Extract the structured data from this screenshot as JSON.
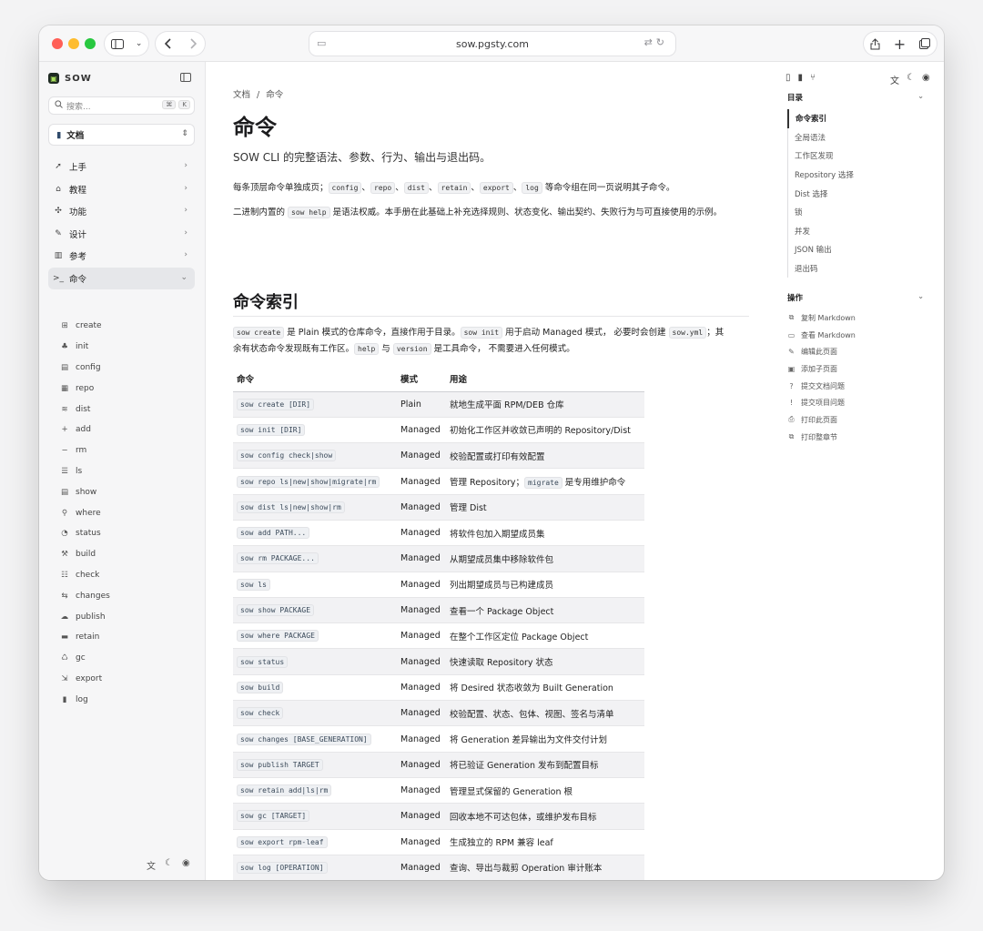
{
  "browser": {
    "url": "sow.pgsty.com",
    "back_icon": "chevron-left-icon",
    "forward_icon": "chevron-right-icon"
  },
  "sidebar": {
    "brand": "SOW",
    "search_placeholder": "搜索...",
    "search_kbd_1": "⌘",
    "search_kbd_2": "K",
    "doc_select": "文档",
    "nav": [
      {
        "label": "上手",
        "icon": "rocket-icon"
      },
      {
        "label": "教程",
        "icon": "graduation-cap-icon"
      },
      {
        "label": "功能",
        "icon": "puzzle-icon"
      },
      {
        "label": "设计",
        "icon": "compass-icon"
      },
      {
        "label": "参考",
        "icon": "book-icon"
      },
      {
        "label": "命令",
        "icon": "terminal-icon"
      }
    ],
    "subnav": [
      "create",
      "init",
      "config",
      "repo",
      "dist",
      "add",
      "rm",
      "ls",
      "show",
      "where",
      "status",
      "build",
      "check",
      "changes",
      "publish",
      "retain",
      "gc",
      "export",
      "log"
    ]
  },
  "main": {
    "breadcrumb_root": "文档",
    "breadcrumb_sep": "/",
    "breadcrumb_current": "命令",
    "title": "命令",
    "lead": "SOW CLI 的完整语法、参数、行为、输出与退出码。",
    "p1": {
      "text_a": "每条顶层命令单独成页；",
      "codes": [
        "config",
        "repo",
        "dist",
        "retain",
        "export",
        "log"
      ],
      "sep": "、",
      "text_b": " 等命令组在同一页说明其子命令。"
    },
    "p2": {
      "text_a": "二进制内置的 ",
      "code": "sow help",
      "text_b": " 是语法权威。本手册在此基础上补充选择规则、状态变化、输出契约、失败行为与可直接使用的示例。"
    },
    "section_title": "命令索引",
    "p3": {
      "code1": "sow create",
      "t1": " 是 Plain 模式的仓库命令，直接作用于目录。",
      "code2": "sow init",
      "t2": " 用于启动 Managed 模式， 必要时会创建 ",
      "code3": "sow.yml",
      "t3": "；其余有状态命令发现既有工作区。",
      "code4": "help",
      "t4": " 与 ",
      "code5": "version",
      "t5": " 是工具命令， 不需要进入任何模式。"
    },
    "table": {
      "headers": [
        "命令",
        "模式",
        "用途"
      ],
      "rows": [
        {
          "cmd": "sow create [DIR]",
          "mode": "Plain",
          "use": "就地生成平面 RPM/DEB 仓库"
        },
        {
          "cmd": "sow init [DIR]",
          "mode": "Managed",
          "use": "初始化工作区并收敛已声明的 Repository/Dist"
        },
        {
          "cmd": "sow config check|show",
          "mode": "Managed",
          "use": "校验配置或打印有效配置"
        },
        {
          "cmd": "sow repo ls|new|show|migrate|rm",
          "mode": "Managed",
          "use": "管理 Repository；",
          "use_code": "migrate",
          "use_tail": " 是专用维护命令"
        },
        {
          "cmd": "sow dist ls|new|show|rm",
          "mode": "Managed",
          "use": "管理 Dist"
        },
        {
          "cmd": "sow add PATH...",
          "mode": "Managed",
          "use": "将软件包加入期望成员集"
        },
        {
          "cmd": "sow rm PACKAGE...",
          "mode": "Managed",
          "use": "从期望成员集中移除软件包"
        },
        {
          "cmd": "sow ls",
          "mode": "Managed",
          "use": "列出期望成员与已构建成员"
        },
        {
          "cmd": "sow show PACKAGE",
          "mode": "Managed",
          "use": "查看一个 Package Object"
        },
        {
          "cmd": "sow where PACKAGE",
          "mode": "Managed",
          "use": "在整个工作区定位 Package Object"
        },
        {
          "cmd": "sow status",
          "mode": "Managed",
          "use": "快速读取 Repository 状态"
        },
        {
          "cmd": "sow build",
          "mode": "Managed",
          "use": "将 Desired 状态收敛为 Built Generation"
        },
        {
          "cmd": "sow check",
          "mode": "Managed",
          "use": "校验配置、状态、包体、视图、签名与清单"
        },
        {
          "cmd": "sow changes [BASE_GENERATION]",
          "mode": "Managed",
          "use": "将 Generation 差异输出为文件交付计划"
        },
        {
          "cmd": "sow publish TARGET",
          "mode": "Managed",
          "use": "将已验证 Generation 发布到配置目标"
        },
        {
          "cmd": "sow retain add|ls|rm",
          "mode": "Managed",
          "use": "管理显式保留的 Generation 根"
        },
        {
          "cmd": "sow gc [TARGET]",
          "mode": "Managed",
          "use": "回收本地不可达包体，或维护发布目标"
        },
        {
          "cmd": "sow export rpm-leaf",
          "mode": "Managed",
          "use": "生成独立的 RPM 兼容 leaf"
        },
        {
          "cmd": "sow log [OPERATION]",
          "mode": "Managed",
          "use": "查询、导出与裁剪 Operation 审计账本"
        }
      ]
    }
  },
  "toc": {
    "heading": "目录",
    "items": [
      "命令索引",
      "全局语法",
      "工作区发现",
      "Repository 选择",
      "Dist 选择",
      "锁",
      "并发",
      "JSON 输出",
      "退出码"
    ],
    "actions_heading": "操作",
    "actions": [
      {
        "label": "复制 Markdown",
        "icon": "copy-icon"
      },
      {
        "label": "查看 Markdown",
        "icon": "markdown-icon"
      },
      {
        "label": "编辑此页面",
        "icon": "pencil-icon"
      },
      {
        "label": "添加子页面",
        "icon": "file-plus-icon"
      },
      {
        "label": "提交文档问题",
        "icon": "help-circle-icon"
      },
      {
        "label": "提交项目问题",
        "icon": "alert-circle-icon"
      },
      {
        "label": "打印此页面",
        "icon": "printer-icon"
      },
      {
        "label": "打印整章节",
        "icon": "printer-stack-icon"
      }
    ]
  }
}
